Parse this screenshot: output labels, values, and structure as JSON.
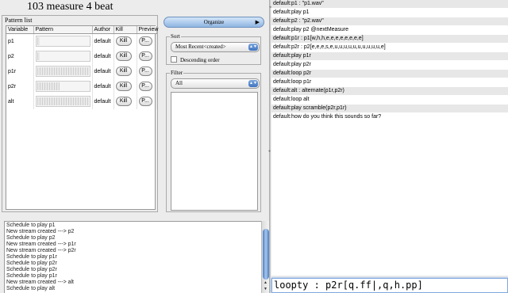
{
  "header": {
    "title": "103 measure 4 beat"
  },
  "pattern_list": {
    "label": "Pattern list",
    "columns": [
      "Variable",
      "Pattern",
      "Author",
      "Kill",
      "Preview"
    ],
    "rows": [
      {
        "variable": "p1",
        "author": "default",
        "kill": "Kill",
        "preview": "P...",
        "pattern_fill_pct": 8
      },
      {
        "variable": "p2",
        "author": "default",
        "kill": "Kill",
        "preview": "P...",
        "pattern_fill_pct": 8
      },
      {
        "variable": "p1r",
        "author": "default",
        "kill": "Kill",
        "preview": "P...",
        "pattern_fill_pct": 100
      },
      {
        "variable": "p2r",
        "author": "default",
        "kill": "Kill",
        "preview": "P...",
        "pattern_fill_pct": 45
      },
      {
        "variable": "alt",
        "author": "default",
        "kill": "Kill",
        "preview": "P...",
        "pattern_fill_pct": 100
      }
    ]
  },
  "organize": {
    "button_label": "Organize",
    "arrow": "▶"
  },
  "sort": {
    "label": "Sort",
    "selected": "Most Recent<created>",
    "descending_label": "Descending order",
    "descending_checked": false
  },
  "filter": {
    "label": "Filter",
    "selected": "All"
  },
  "schedule_log": [
    "Schedule to play p1",
    "New stream created ---> p2",
    "Schedule to play p2",
    "New stream created ---> p1r",
    "New stream created ---> p2r",
    "Schedule to play p1r",
    "Schedule to play p2r",
    "Schedule to play p2r",
    "Schedule to play p1r",
    "New stream created ---> alt",
    "Schedule to play alt"
  ],
  "console": [
    "default:p1 : \"p1.wav\"",
    "default:play p1",
    "default:p2 : \"p2.wav\"",
    "default:play p2 @nextMeasure",
    "default:p1r : p1[w,h,h,e,e,e,e,e,e,e,e]",
    "default:p2r : p2[e,e,e,s,e,u,u,u,u,u,u,u,u,u,u,e]",
    "default:play p1r",
    "default:play p2r",
    "default:loop p2r",
    "default:loop p1r",
    "default:alt : alternate(p1r,p2r)",
    "default:loop alt",
    "default:play scramble(p2r,p1r)",
    "default:how do you think this sounds so far?"
  ],
  "command": {
    "value": "loopty : p2r[q.ff|,q,h.pp]"
  }
}
